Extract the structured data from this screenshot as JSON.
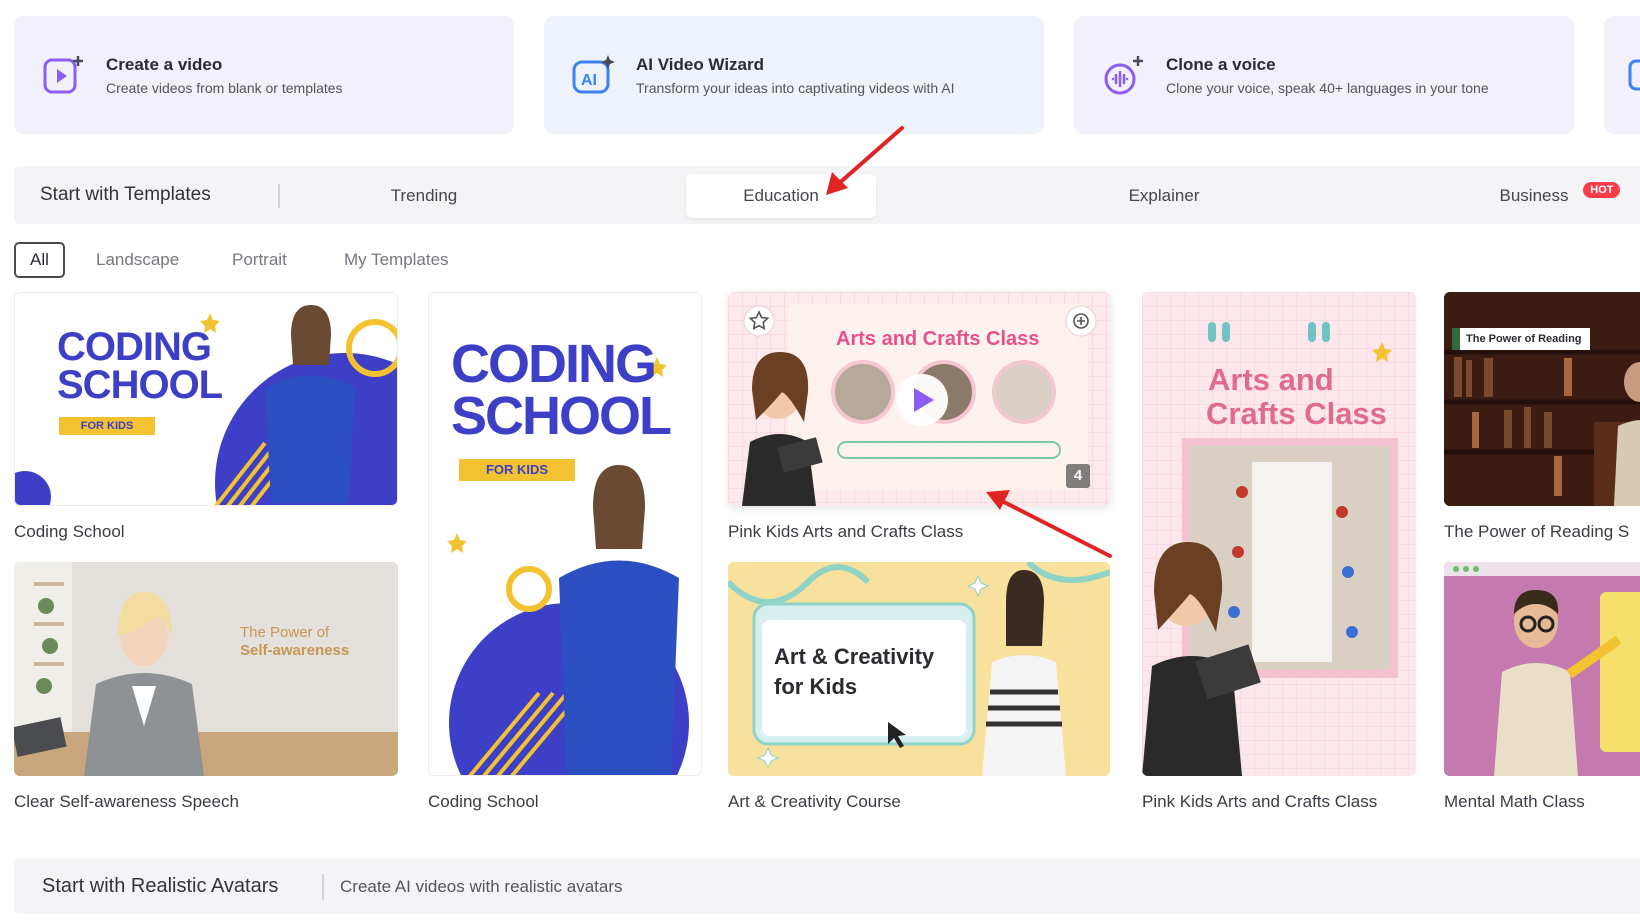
{
  "features": [
    {
      "title": "Create a video",
      "desc": "Create videos from blank or templates",
      "icon": "create-video-icon"
    },
    {
      "title": "AI Video Wizard",
      "desc": "Transform your ideas into captivating videos with AI",
      "icon": "ai-wizard-icon"
    },
    {
      "title": "Clone a voice",
      "desc": "Clone your voice, speak 40+ languages in your tone",
      "icon": "clone-voice-icon"
    }
  ],
  "templates_bar": {
    "title": "Start with Templates",
    "tabs": [
      "Trending",
      "Education",
      "Explainer",
      "Business"
    ],
    "active_tab": "Education",
    "hot_badge": "HOT"
  },
  "filters": {
    "items": [
      "All",
      "Landscape",
      "Portrait",
      "My Templates"
    ],
    "active": "All"
  },
  "templates": [
    {
      "name": "Coding School"
    },
    {
      "name": "Coding School"
    },
    {
      "name": "Pink Kids Arts and Crafts Class"
    },
    {
      "name": "Pink Kids Arts and Crafts Class"
    },
    {
      "name": "The Power of Reading S"
    },
    {
      "name": "Clear Self-awareness Speech"
    },
    {
      "name": "Art & Creativity Course"
    },
    {
      "name": "Mental Math Class"
    }
  ],
  "thumb_text": {
    "coding_l1": "CODING",
    "coding_l2": "SCHOOL",
    "for_kids": "FOR KIDS",
    "arts_title": "Arts and Crafts Class",
    "arts_l1": "Arts and",
    "arts_l2": "Crafts Class",
    "scene_count": "4",
    "self_l1": "The Power of",
    "self_l2": "Self-awareness",
    "art_l1": "Art & Creativity",
    "art_l2": "for Kids",
    "reading_banner": "The Power of Reading"
  },
  "avatars_bar": {
    "title": "Start with Realistic Avatars",
    "desc": "Create AI videos with realistic avatars"
  },
  "colors": {
    "accent_purple": "#7b4fe0",
    "coding_blue": "#3d3fc7",
    "arrow_red": "#e02424",
    "hot_red": "#ff3b4a"
  }
}
